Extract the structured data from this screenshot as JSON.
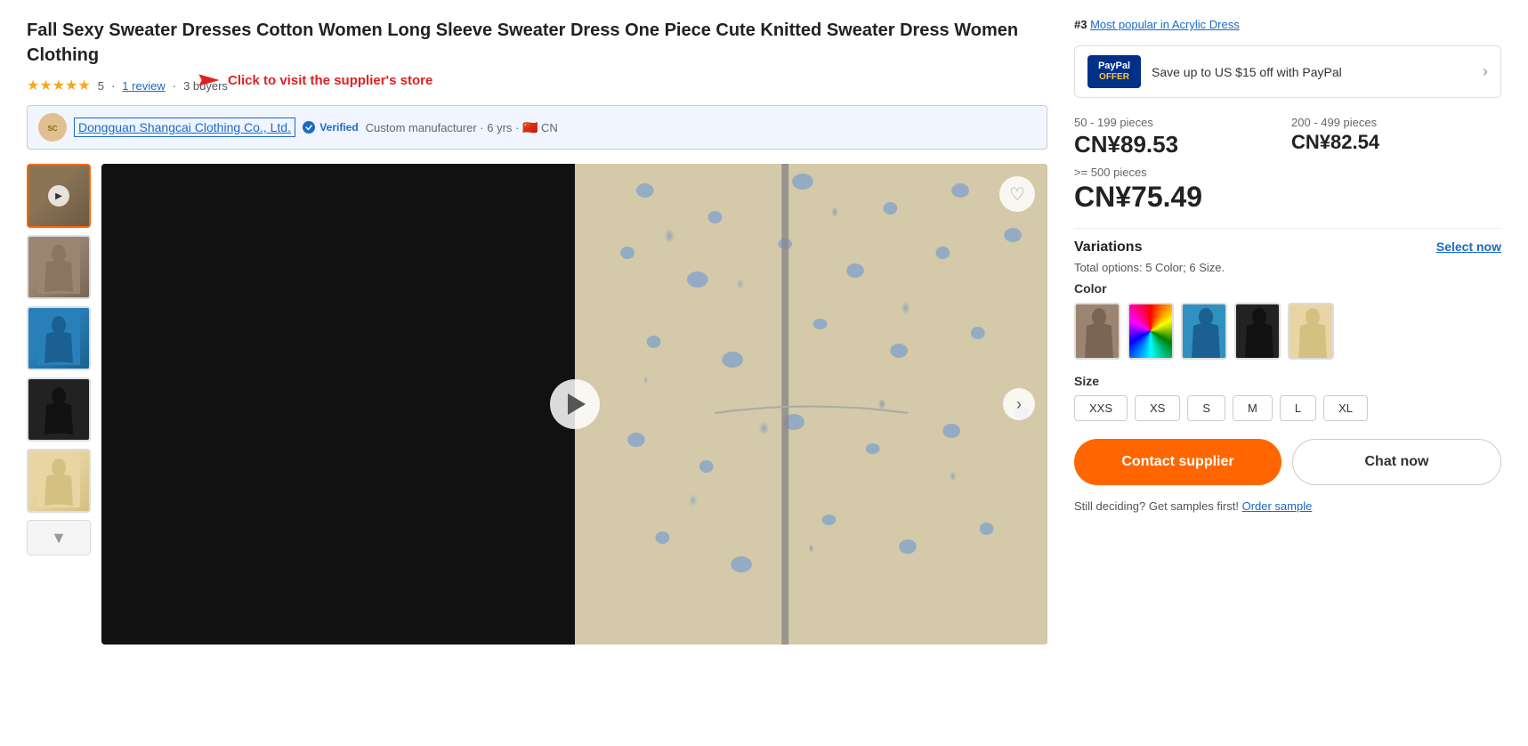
{
  "product": {
    "title": "Fall Sexy Sweater Dresses Cotton Women Long Sleeve Sweater Dress One Piece Cute Knitted Sweater Dress Women Clothing",
    "rating": "5",
    "reviews": "1 review",
    "buyers": "3 buyers"
  },
  "supplier": {
    "name": "Dongguan Shangcai Clothing Co., Ltd.",
    "verified": "Verified",
    "type": "Custom manufacturer",
    "years": "6 yrs",
    "country": "CN",
    "tooltip": "Click to visit the supplier's store"
  },
  "popularity": {
    "rank": "#3",
    "category_link": "Most popular in Acrylic Dress"
  },
  "paypal": {
    "logo_line1": "PayPal",
    "logo_line2": "OFFER",
    "description": "Save up to US $15 off with PayPal"
  },
  "pricing": {
    "tier1": {
      "range": "50 - 199 pieces",
      "price": "CN¥89.53"
    },
    "tier2": {
      "range": "200 - 499 pieces",
      "price": "CN¥82.54"
    },
    "tier3": {
      "range": ">= 500 pieces",
      "price": "CN¥75.49"
    }
  },
  "variations": {
    "title": "Variations",
    "meta": "Total options: 5 Color; 6 Size.",
    "select_now": "Select now",
    "color_label": "Color",
    "size_label": "Size",
    "colors": [
      "brown",
      "multicolor",
      "blue",
      "black",
      "cream"
    ],
    "sizes": [
      "XXS",
      "XS",
      "S",
      "M",
      "L",
      "XL"
    ]
  },
  "buttons": {
    "contact_supplier": "Contact supplier",
    "chat_now": "Chat now"
  },
  "footer": {
    "still_deciding": "Still deciding? Get samples first!",
    "order_sample": "Order sample"
  }
}
